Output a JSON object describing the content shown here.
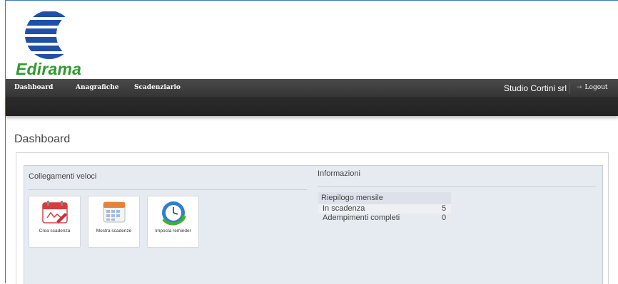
{
  "brand": {
    "logo_text": "Edirama"
  },
  "navbar": {
    "items": [
      "Dashboard",
      "Anagrafiche",
      "Scadenziario"
    ],
    "user": "Studio Cortini srl",
    "logout_label": "Logout"
  },
  "page": {
    "title": "Dashboard"
  },
  "quick_links": {
    "title": "Collegamenti veloci",
    "tiles": [
      {
        "label": "Crea scadenza",
        "icon": "calendar-pen-icon"
      },
      {
        "label": "Mostra scadenze",
        "icon": "calendar-grid-icon"
      },
      {
        "label": "Imposta reminder",
        "icon": "clock-refresh-icon"
      }
    ]
  },
  "info": {
    "title": "Informazioni",
    "summary_title": "Riepilogo mensile",
    "rows": [
      {
        "label": "In scadenza",
        "value": "5"
      },
      {
        "label": "Adempimenti completi",
        "value": "0"
      }
    ]
  },
  "colors": {
    "nav_bg": "#3d3d3d",
    "logo_blue": "#1f4fa6",
    "logo_green": "#2f9a2f",
    "panel_bg": "#e6eaf1"
  }
}
